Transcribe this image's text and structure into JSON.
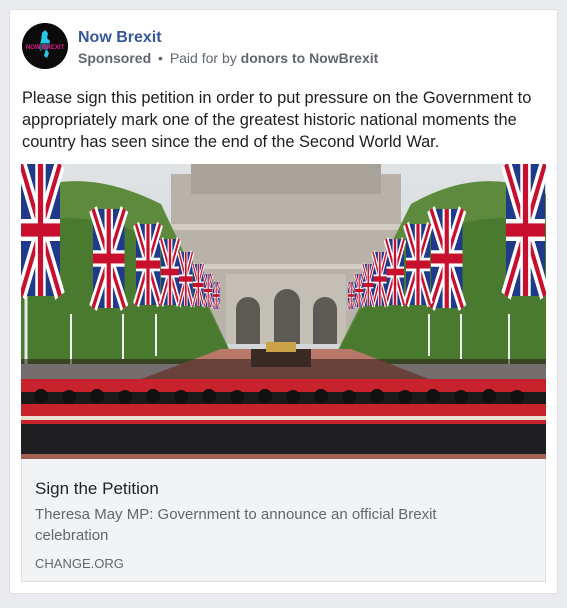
{
  "post": {
    "page_name": "Now Brexit",
    "sponsored_label": "Sponsored",
    "separator": "•",
    "paid_for_prefix": "Paid for by",
    "sponsor_name": "donors to NowBrexit",
    "avatar_icon": "now-brexit-logo",
    "avatar_text": "NOW BREXIT",
    "body_text": "Please sign this petition in order to put pressure on the Government to appropriately mark one of the greatest historic national moments the country has seen since the end of the Second World War."
  },
  "image": {
    "subject": "trooping-the-colour-photo"
  },
  "link_preview": {
    "title": "Sign the Petition",
    "description": "Theresa May MP: Government to announce an official Brexit celebration",
    "domain": "CHANGE.ORG"
  },
  "colors": {
    "link_blue": "#365899",
    "text_dark": "#1c1e21",
    "text_grey": "#616770",
    "preview_bg": "#f2f3f5"
  }
}
